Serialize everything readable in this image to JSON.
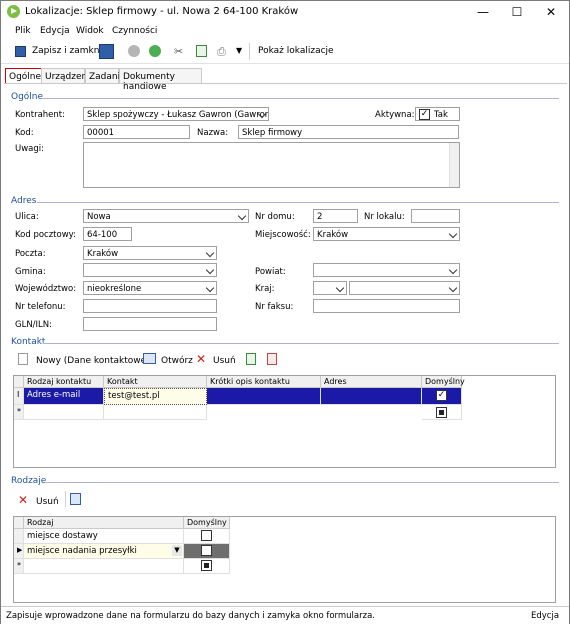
{
  "window": {
    "title": "Lokalizacje: Sklep firmowy - ul. Nowa 2 64-100 Kraków",
    "min": "—",
    "max": "☐",
    "close": "✕"
  },
  "menu": [
    "Plik",
    "Edycja",
    "Widok",
    "Czynności"
  ],
  "toolbar": {
    "save_close": "Zapisz i zamknij",
    "show_location": "Pokaż lokalizacje"
  },
  "tabs": [
    "Ogólne",
    "Urządzenia",
    "Zadania",
    "Dokumenty handlowe"
  ],
  "general": {
    "section": "Ogólne",
    "contractor_label": "Kontrahent:",
    "contractor_value": "Sklep spożywczy - Łukasz Gawron (Gawron)",
    "active_label": "Aktywna:",
    "active_value": "Tak",
    "code_label": "Kod:",
    "code_value": "00001",
    "name_label": "Nazwa:",
    "name_value": "Sklep firmowy",
    "notes_label": "Uwagi:"
  },
  "address": {
    "section": "Adres",
    "street_label": "Ulica:",
    "street_value": "Nowa",
    "house_label": "Nr domu:",
    "house_value": "2",
    "flat_label": "Nr lokalu:",
    "flat_value": "",
    "postal_label": "Kod pocztowy:",
    "postal_value": "64-100",
    "city_label": "Miejscowość:",
    "city_value": "Kraków",
    "post_label": "Poczta:",
    "post_value": "Kraków",
    "commune_label": "Gmina:",
    "commune_value": "",
    "county_label": "Powiat:",
    "county_value": "",
    "voiv_label": "Województwo:",
    "voiv_value": "nieokreślone",
    "country_label": "Kraj:",
    "phone_label": "Nr telefonu:",
    "fax_label": "Nr faksu:",
    "gln_label": "GLN/ILN:"
  },
  "contact": {
    "section": "Kontakt",
    "new_btn": "Nowy (Dane kontaktowe)",
    "open_btn": "Otwórz",
    "delete_btn": "Usuń",
    "cols": [
      "Rodzaj kontaktu",
      "Kontakt",
      "Krótki opis kontaktu",
      "Adres",
      "Domyślny"
    ],
    "row": {
      "type": "Adres e-mail",
      "contact": "test@test.pl",
      "desc": "",
      "address": ""
    },
    "edit_marker": "I",
    "new_marker": "*"
  },
  "kinds": {
    "section": "Rodzaje",
    "delete_btn": "Usuń",
    "cols": [
      "Rodzaj",
      "Domyślny"
    ],
    "rows": [
      "miejsce dostawy",
      "miejsce nadania przesyłki"
    ],
    "cur_marker": "▶",
    "new_marker": "*"
  },
  "status": {
    "text": "Zapisuje wprowadzone dane na formularzu do bazy danych i zamyka okno formularza.",
    "mode": "Edycja"
  },
  "colors": {
    "accent": "#1f4e9c",
    "selection": "#1a1aa6"
  }
}
